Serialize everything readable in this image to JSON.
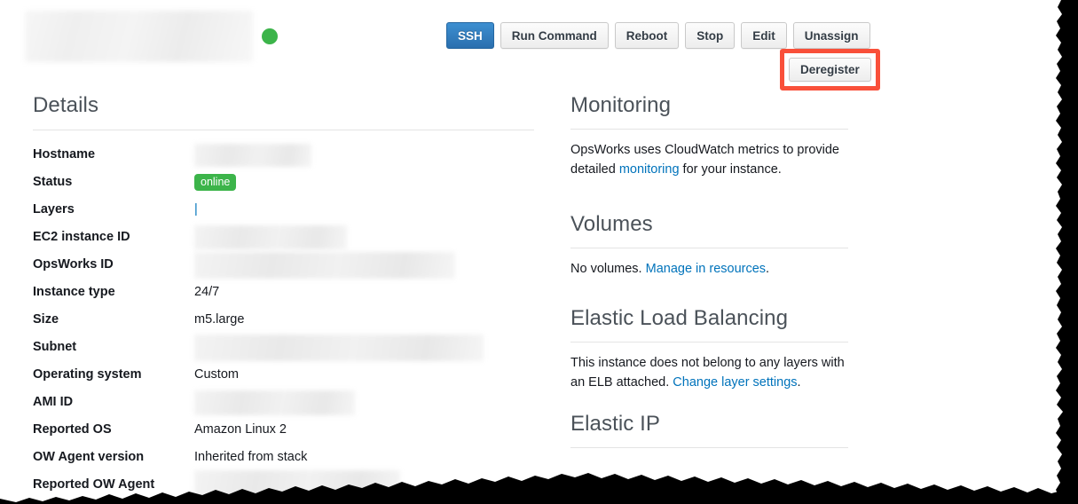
{
  "header": {
    "title_redacted": "",
    "status_indicator": "online-green-dot",
    "actions": [
      {
        "label": "SSH",
        "style": "primary"
      },
      {
        "label": "Run Command",
        "style": "default"
      },
      {
        "label": "Reboot",
        "style": "default"
      },
      {
        "label": "Stop",
        "style": "default"
      },
      {
        "label": "Edit",
        "style": "default"
      },
      {
        "label": "Unassign",
        "style": "default"
      }
    ],
    "deregister": {
      "label": "Deregister",
      "highlight_color": "#f9503a"
    }
  },
  "details": {
    "heading": "Details",
    "rows": [
      {
        "label": "Hostname",
        "value": "",
        "kind": "redacted"
      },
      {
        "label": "Status",
        "value": "online",
        "kind": "badge"
      },
      {
        "label": "Layers",
        "value": "|",
        "kind": "link"
      },
      {
        "label": "EC2 instance ID",
        "value": "",
        "kind": "redacted"
      },
      {
        "label": "OpsWorks ID",
        "value": "",
        "kind": "redacted"
      },
      {
        "label": "Instance type",
        "value": "24/7",
        "kind": "text"
      },
      {
        "label": "Size",
        "value": "m5.large",
        "kind": "text"
      },
      {
        "label": "Subnet",
        "value": "",
        "kind": "redacted"
      },
      {
        "label": "Operating system",
        "value": "Custom",
        "kind": "text"
      },
      {
        "label": "AMI ID",
        "value": "",
        "kind": "redacted"
      },
      {
        "label": "Reported OS",
        "value": "Amazon Linux 2",
        "kind": "text"
      },
      {
        "label": "OW Agent version",
        "value": "Inherited from stack",
        "kind": "text"
      },
      {
        "label": "Reported OW Agent",
        "value": "",
        "kind": "redacted"
      }
    ]
  },
  "monitoring": {
    "heading": "Monitoring",
    "text_before": "OpsWorks uses CloudWatch metrics to provide detailed ",
    "link": "monitoring",
    "text_after": " for your instance."
  },
  "volumes": {
    "heading": "Volumes",
    "text_before": "No volumes. ",
    "link": "Manage in resources",
    "text_after": "."
  },
  "elb": {
    "heading": "Elastic Load Balancing",
    "text_before": "This instance does not belong to any layers with an ELB attached. ",
    "link": "Change layer settings",
    "text_after": "."
  },
  "elastic_ip": {
    "heading": "Elastic IP"
  },
  "colors": {
    "accent_blue": "#0073bb",
    "primary_button": "#2a6fae",
    "status_green": "#3cb44a",
    "highlight_red": "#f9503a",
    "heading_gray": "#4b5259"
  }
}
